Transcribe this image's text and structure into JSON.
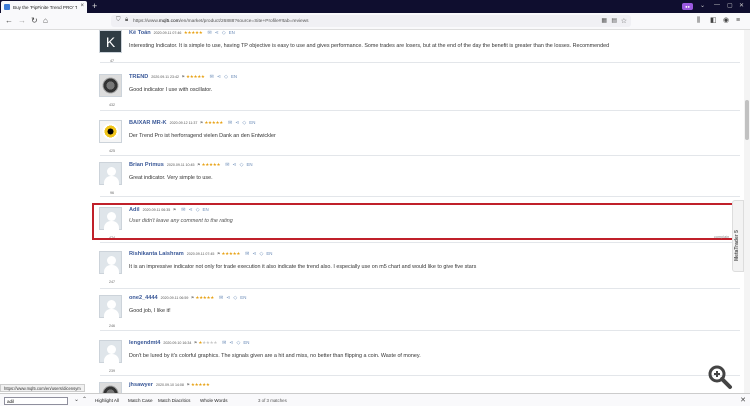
{
  "tab": {
    "title": "Buy the 'PipFinite Trend PRO' T"
  },
  "browser": {
    "url_prefix": "https://www.",
    "url_domain": "mql5.com",
    "url_path": "/en/market/product/26888?source=Site+Profile#!tab=reviews"
  },
  "reviews": [
    {
      "name": "Kế Toán",
      "date": "2020.09.11 07:46",
      "stars": 5,
      "lang": "EN",
      "rating": "47",
      "avatar_letter": "K",
      "text": "Interesting Indicator. It is simple to use, having TP objective is easy to use and gives performance. Some trades are losers, but at the end of the day the benefit is greater than the losses. Recommended",
      "italic": false
    },
    {
      "name": "TREND",
      "date": "2020.09.11 23:42",
      "stars": 5,
      "lang": "EN",
      "rating": "432",
      "text": "Good indicator I use with oscillator.",
      "italic": false
    },
    {
      "name": "BAIXAR MR-K",
      "date": "2020.09.12 11:37",
      "stars": 5,
      "lang": "EN",
      "rating": "425",
      "text": "Der Trend Pro ist herforragend vielen Dank an den Entwickler",
      "italic": false
    },
    {
      "name": "Brian Primus",
      "date": "2020.09.11 10:45",
      "stars": 5,
      "lang": "EN",
      "rating": "96",
      "text": "Great indicator. Very simple to use.",
      "italic": false
    },
    {
      "name": "Adil",
      "date": "2020.09.11 06:35",
      "stars": 0,
      "lang": "EN",
      "rating": "474",
      "text": "User didn't leave any comment to the rating",
      "italic": true
    },
    {
      "name": "Rishikanta Laishram",
      "date": "2020.09.11 07:45",
      "stars": 5,
      "lang": "EN",
      "rating": "247",
      "text": "It is an impressive indicator not only for trade execution it also indicate the trend also. I especially use on m5 chart and would like to give five stars",
      "italic": false
    },
    {
      "name": "one2_4444",
      "date": "2020.09.11 06:59",
      "stars": 5,
      "lang": "EN",
      "rating": "246",
      "text": "Good job, I like it!",
      "italic": false
    },
    {
      "name": "lengendmt4",
      "date": "2020.09.10 16:34",
      "stars": 1,
      "lang": "EN",
      "rating": "239",
      "text": "Don't be lured by it's colorful graphics. The signals given are a hit and miss, no better than flipping a coin. Waste of money.",
      "italic": false
    },
    {
      "name": "jhsawyer",
      "date": "2020.09.10 14:08",
      "stars": 5,
      "lang": "EN",
      "rating": "",
      "text": "",
      "italic": false
    }
  ],
  "labels": {
    "complain": "complain",
    "sidetab": "MetaTrader 5"
  },
  "status_url": "https://www.mql5.com/en/users/dicensym",
  "findbar": {
    "query": "adil",
    "highlight_all": "Highlight All",
    "match_case": "Match Case",
    "match_diacritics": "Match Diacritics",
    "whole_words": "Whole Words",
    "count": "3 of 3 matches"
  },
  "colors": {
    "highlight_border": "#c0202a",
    "name_link": "#3b5998",
    "star": "#e8a317"
  }
}
